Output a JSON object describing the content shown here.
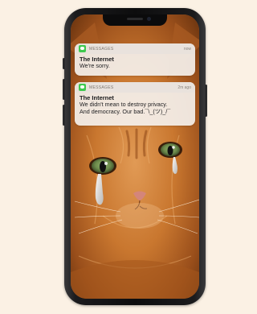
{
  "notifications": [
    {
      "app": "MESSAGES",
      "time": "now",
      "sender": "The Internet",
      "message_lines": [
        "We're sorry."
      ]
    },
    {
      "app": "MESSAGES",
      "time": "2m ago",
      "sender": "The Internet",
      "message_lines": [
        "We didn't mean to destroy privacy.",
        "And democracy. Our bad.¯\\_(ツ)_/¯"
      ]
    }
  ],
  "wallpaper": "crying-kitten",
  "colors": {
    "background": "#fbf1e4",
    "messages_icon": "#3ec94e",
    "fur": "#c46b2c"
  }
}
